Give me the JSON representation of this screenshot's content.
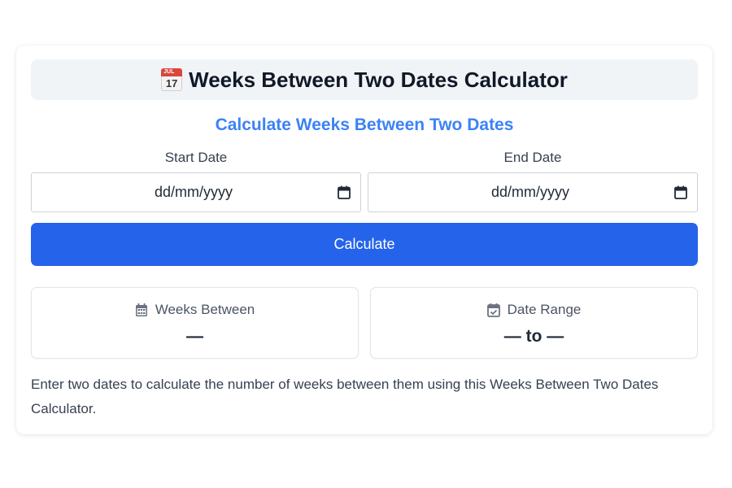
{
  "header": {
    "icon": "calendar-emoji-icon",
    "icon_month": "JUL",
    "icon_day": "17",
    "title": "Weeks Between Two Dates Calculator"
  },
  "subtitle": "Calculate Weeks Between Two Dates",
  "form": {
    "start_label": "Start Date",
    "start_placeholder": "dd/mm/yyyy",
    "end_label": "End Date",
    "end_placeholder": "dd/mm/yyyy",
    "calculate_label": "Calculate"
  },
  "results": {
    "weeks": {
      "icon": "calendar-grid-icon",
      "label": "Weeks Between",
      "value": "—"
    },
    "range": {
      "icon": "calendar-check-icon",
      "label": "Date Range",
      "value": "— to —"
    }
  },
  "help_text": "Enter two dates to calculate the number of weeks between them using this Weeks Between Two Dates Calculator.",
  "colors": {
    "accent": "#2563eb",
    "subtitle": "#3b82f6",
    "title_bg": "#f1f4f7"
  }
}
